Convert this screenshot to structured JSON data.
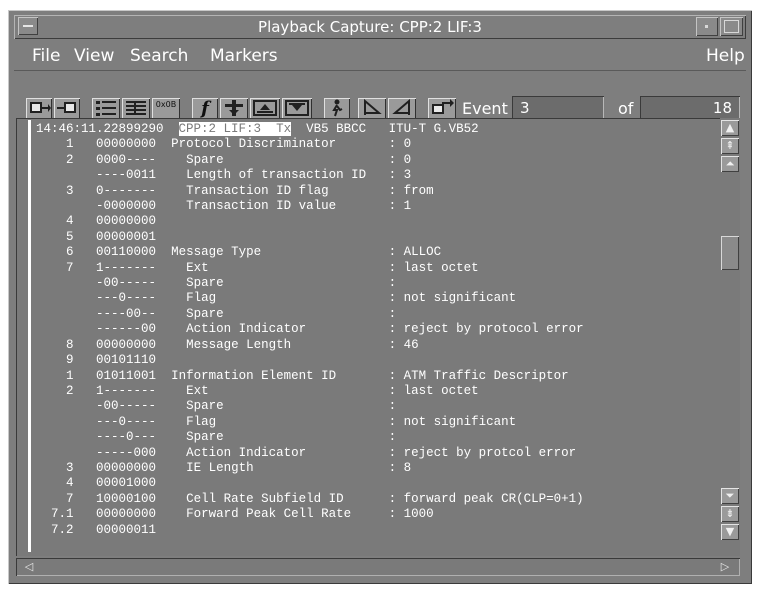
{
  "window": {
    "title": "Playback Capture: CPP:2 LIF:3"
  },
  "menu": {
    "file": "File",
    "view": "View",
    "search": "Search",
    "markers": "Markers",
    "help": "Help"
  },
  "toolbar": {
    "event_label": "Event",
    "event_value": "3",
    "of_label": "of",
    "event_total": "18",
    "button_texts": {
      "hex": "0x0B",
      "function": "f"
    }
  },
  "trace": {
    "header": {
      "time": "14:46:11.22899290",
      "source": "CPP:2 LIF:3  Tx",
      "rest": "VB5 BBCC   ITU-T G.VB52"
    },
    "rows": [
      {
        "num": "1",
        "bits": "00000000",
        "field": "Protocol Discriminator",
        "value": ": 0"
      },
      {
        "num": "2",
        "bits": "0000----",
        "field": "  Spare",
        "value": ": 0"
      },
      {
        "num": "",
        "bits": "----0011",
        "field": "  Length of transaction ID",
        "value": ": 3"
      },
      {
        "num": "3",
        "bits": "0-------",
        "field": "  Transaction ID flag",
        "value": ": from"
      },
      {
        "num": "",
        "bits": "-0000000",
        "field": "  Transaction ID value",
        "value": ": 1"
      },
      {
        "num": "4",
        "bits": "00000000",
        "field": "",
        "value": ""
      },
      {
        "num": "5",
        "bits": "00000001",
        "field": "",
        "value": ""
      },
      {
        "num": "6",
        "bits": "00110000",
        "field": "Message Type",
        "value": ": ALLOC"
      },
      {
        "num": "7",
        "bits": "1-------",
        "field": "  Ext",
        "value": ": last octet"
      },
      {
        "num": "",
        "bits": "-00-----",
        "field": "  Spare",
        "value": ":"
      },
      {
        "num": "",
        "bits": "---0----",
        "field": "  Flag",
        "value": ": not significant"
      },
      {
        "num": "",
        "bits": "----00--",
        "field": "  Spare",
        "value": ":"
      },
      {
        "num": "",
        "bits": "------00",
        "field": "  Action Indicator",
        "value": ": reject by protocol error"
      },
      {
        "num": "8",
        "bits": "00000000",
        "field": "  Message Length",
        "value": ": 46"
      },
      {
        "num": "9",
        "bits": "00101110",
        "field": "",
        "value": ""
      },
      {
        "num": "1",
        "bits": "01011001",
        "field": "Information Element ID",
        "value": ": ATM Traffic Descriptor"
      },
      {
        "num": "2",
        "bits": "1-------",
        "field": "  Ext",
        "value": ": last octet"
      },
      {
        "num": "",
        "bits": "-00-----",
        "field": "  Spare",
        "value": ":"
      },
      {
        "num": "",
        "bits": "---0----",
        "field": "  Flag",
        "value": ": not significant"
      },
      {
        "num": "",
        "bits": "----0---",
        "field": "  Spare",
        "value": ":"
      },
      {
        "num": "",
        "bits": "-----000",
        "field": "  Action Indicator",
        "value": ": reject by protcol error"
      },
      {
        "num": "3",
        "bits": "00000000",
        "field": "  IE Length",
        "value": ": 8"
      },
      {
        "num": "4",
        "bits": "00001000",
        "field": "",
        "value": ""
      },
      {
        "num": "7",
        "bits": "10000100",
        "field": "  Cell Rate Subfield ID",
        "value": ": forward peak CR(CLP=0+1)"
      },
      {
        "num": "7.1",
        "bits": "00000000",
        "field": "  Forward Peak Cell Rate",
        "value": ": 1000"
      },
      {
        "num": "7.2",
        "bits": "00000011",
        "field": "",
        "value": ""
      }
    ]
  }
}
